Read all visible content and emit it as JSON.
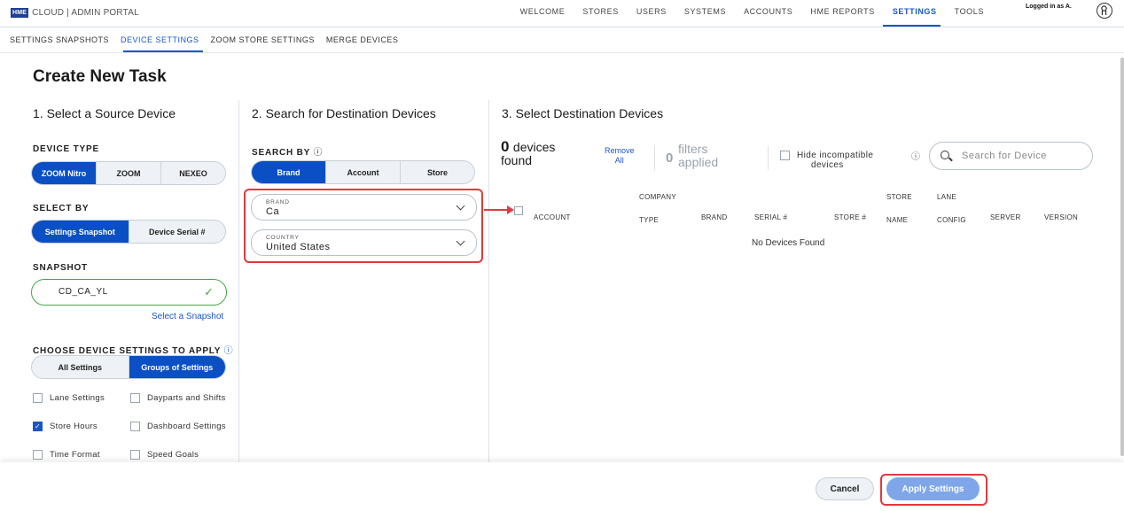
{
  "header": {
    "logo_badge": "HME",
    "logo_text": "CLOUD | ADMIN PORTAL",
    "nav": [
      "WELCOME",
      "STORES",
      "USERS",
      "SYSTEMS",
      "ACCOUNTS",
      "HME REPORTS",
      "SETTINGS",
      "TOOLS"
    ],
    "active_nav": "SETTINGS",
    "logged_in": "Logged in as A."
  },
  "subnav": [
    "SETTINGS SNAPSHOTS",
    "DEVICE SETTINGS",
    "ZOOM STORE SETTINGS",
    "MERGE DEVICES"
  ],
  "page_title": "Create New Task",
  "source": {
    "title": "1. Select a Source Device",
    "device_type_label": "DEVICE TYPE",
    "device_types": [
      "ZOOM Nitro",
      "ZOOM",
      "NEXEO"
    ],
    "select_by_label": "SELECT BY",
    "select_by": [
      "Settings Snapshot",
      "Device Serial #"
    ],
    "snapshot_label": "SNAPSHOT",
    "snapshot_value": "CD_CA_YL",
    "select_snapshot_link": "Select a Snapshot",
    "choose_label": "CHOOSE DEVICE SETTINGS TO APPLY",
    "choose_options": [
      "All Settings",
      "Groups of Settings"
    ],
    "settings": [
      {
        "label": "Lane Settings",
        "checked": false
      },
      {
        "label": "Dayparts and Shifts",
        "checked": false
      },
      {
        "label": "Store Hours",
        "checked": true
      },
      {
        "label": "Dashboard Settings",
        "checked": false
      },
      {
        "label": "Time Format",
        "checked": false
      },
      {
        "label": "Speed Goals",
        "checked": false
      }
    ]
  },
  "destination_search": {
    "title": "2. Search for Destination Devices",
    "search_by_label": "SEARCH BY",
    "search_by": [
      "Brand",
      "Account",
      "Store"
    ],
    "brand_label": "BRAND",
    "brand_value": "Ca",
    "country_label": "COUNTRY",
    "country_value": "United States"
  },
  "destination_select": {
    "title": "3. Select Destination Devices",
    "count": "0",
    "devices_found": "devices",
    "found": "found",
    "remove_all_1": "Remove",
    "remove_all_2": "All",
    "filters_count": "0",
    "filters_1": "filters",
    "filters_2": "applied",
    "hide_label_1": "Hide incompatible",
    "hide_label_2": "devices",
    "search_placeholder": "Search for Device",
    "columns": [
      {
        "l1": "",
        "l2": "ACCOUNT"
      },
      {
        "l1": "COMPANY",
        "l2": "TYPE"
      },
      {
        "l1": "",
        "l2": "BRAND"
      },
      {
        "l1": "",
        "l2": "SERIAL #"
      },
      {
        "l1": "",
        "l2": "STORE #"
      },
      {
        "l1": "STORE",
        "l2": "NAME"
      },
      {
        "l1": "LANE",
        "l2": "CONFIG"
      },
      {
        "l1": "",
        "l2": "SERVER"
      },
      {
        "l1": "",
        "l2": "VERSION"
      }
    ],
    "empty_text": "No Devices Found"
  },
  "footer": {
    "cancel": "Cancel",
    "apply": "Apply Settings"
  },
  "colors": {
    "primary": "#0b4fc4",
    "link": "#1856c8",
    "success": "#46a74a",
    "highlight": "#e0393e",
    "apply_disabled": "#7fa6e8"
  }
}
